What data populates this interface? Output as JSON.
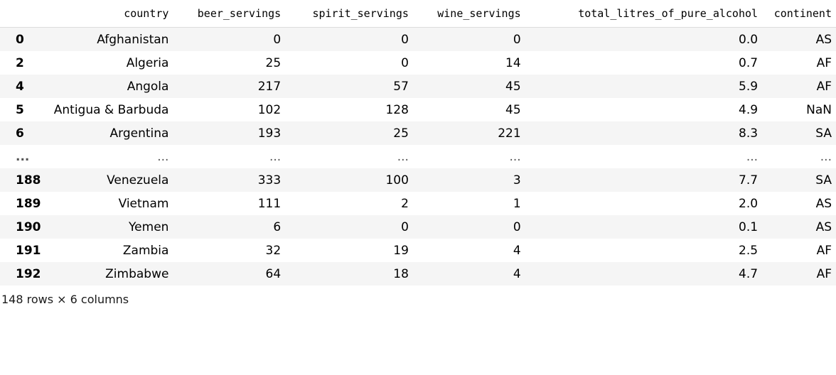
{
  "table": {
    "columns": [
      "",
      "country",
      "beer_servings",
      "spirit_servings",
      "wine_servings",
      "total_litres_of_pure_alcohol",
      "continent"
    ],
    "rows": [
      [
        "0",
        "Afghanistan",
        "0",
        "0",
        "0",
        "0.0",
        "AS"
      ],
      [
        "2",
        "Algeria",
        "25",
        "0",
        "14",
        "0.7",
        "AF"
      ],
      [
        "4",
        "Angola",
        "217",
        "57",
        "45",
        "5.9",
        "AF"
      ],
      [
        "5",
        "Antigua & Barbuda",
        "102",
        "128",
        "45",
        "4.9",
        "NaN"
      ],
      [
        "6",
        "Argentina",
        "193",
        "25",
        "221",
        "8.3",
        "SA"
      ],
      [
        "...",
        "...",
        "...",
        "...",
        "...",
        "...",
        "..."
      ],
      [
        "188",
        "Venezuela",
        "333",
        "100",
        "3",
        "7.7",
        "SA"
      ],
      [
        "189",
        "Vietnam",
        "111",
        "2",
        "1",
        "2.0",
        "AS"
      ],
      [
        "190",
        "Yemen",
        "6",
        "0",
        "0",
        "0.1",
        "AS"
      ],
      [
        "191",
        "Zambia",
        "32",
        "19",
        "4",
        "2.5",
        "AF"
      ],
      [
        "192",
        "Zimbabwe",
        "64",
        "18",
        "4",
        "4.7",
        "AF"
      ]
    ]
  },
  "footer": {
    "summary": "148 rows × 6 columns"
  }
}
